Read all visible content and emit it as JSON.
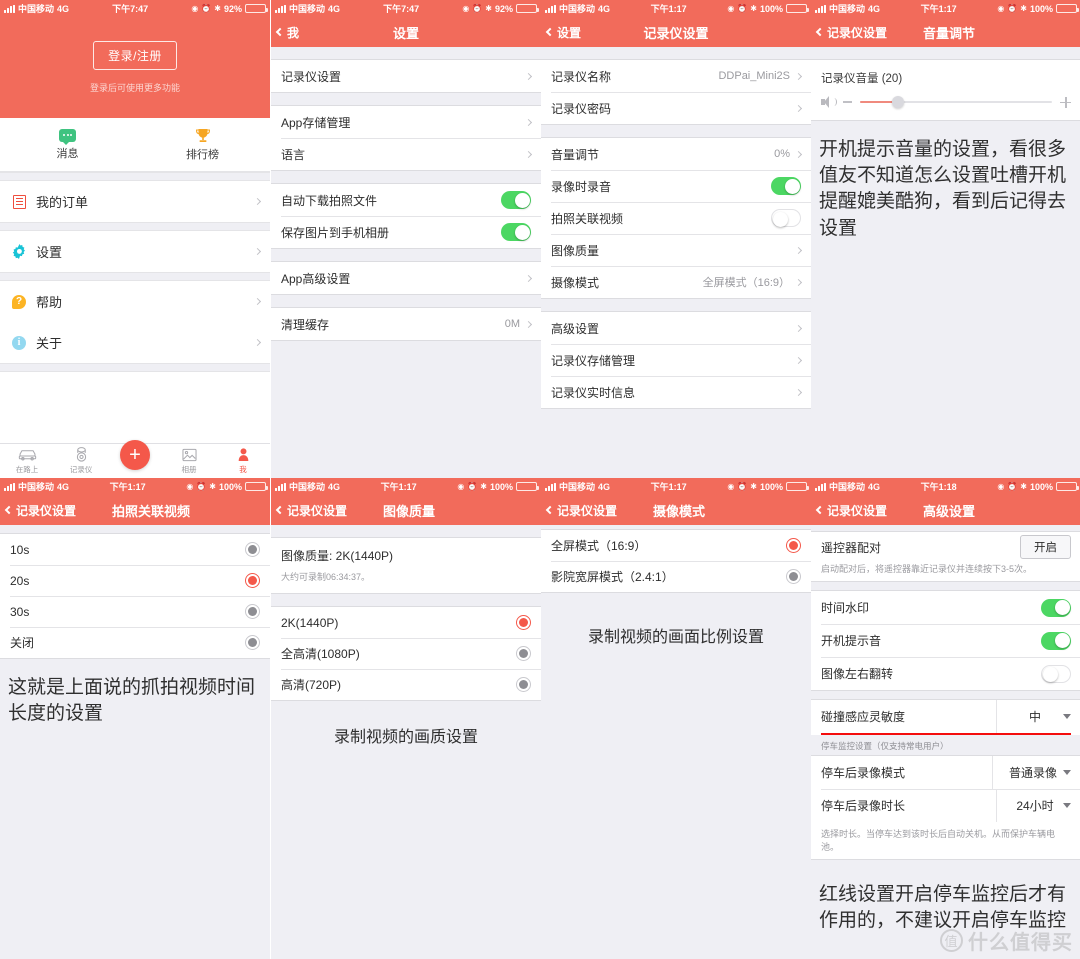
{
  "status_bars": {
    "carrier": "中国移动",
    "network": "4G",
    "time_747": "下午7:47",
    "time_117": "下午1:17",
    "time_118": "下午1:18",
    "battery_92": "92%",
    "battery_100": "100%"
  },
  "panel1": {
    "login_button": "登录/注册",
    "login_hint": "登录后可使用更多功能",
    "quick": [
      {
        "label": "消息",
        "icon": "chat-bubble-icon"
      },
      {
        "label": "排行榜",
        "icon": "trophy-icon"
      }
    ],
    "menu": [
      {
        "label": "我的订单",
        "icon": "order-list-icon"
      },
      {
        "label": "设置",
        "icon": "gear-icon"
      },
      {
        "label": "帮助",
        "icon": "help-icon"
      },
      {
        "label": "关于",
        "icon": "info-icon"
      }
    ],
    "tabs": [
      {
        "label": "在路上",
        "icon": "car-icon",
        "active": false
      },
      {
        "label": "记录仪",
        "icon": "dashcam-icon",
        "active": false
      },
      {
        "label": "",
        "icon": "plus-icon",
        "active": false
      },
      {
        "label": "相册",
        "icon": "photo-icon",
        "active": false
      },
      {
        "label": "我",
        "icon": "person-icon",
        "active": true
      }
    ]
  },
  "panel2": {
    "back": "我",
    "title": "设置",
    "rows_g1": [
      {
        "label": "记录仪设置"
      }
    ],
    "rows_g2": [
      {
        "label": "App存储管理"
      },
      {
        "label": "语言"
      }
    ],
    "rows_g3": [
      {
        "label": "自动下载拍照文件",
        "toggle": "on"
      },
      {
        "label": "保存图片到手机相册",
        "toggle": "on"
      }
    ],
    "rows_g4": [
      {
        "label": "App高级设置"
      }
    ],
    "rows_g5": [
      {
        "label": "清理缓存",
        "value": "0M"
      }
    ]
  },
  "panel3": {
    "back": "设置",
    "title": "记录仪设置",
    "rows_g1": [
      {
        "label": "记录仪名称",
        "value": "DDPai_Mini2S"
      },
      {
        "label": "记录仪密码",
        "value": ""
      }
    ],
    "rows_g2": [
      {
        "label": "音量调节",
        "value": "0%"
      },
      {
        "label": "录像时录音",
        "toggle": "on"
      },
      {
        "label": "拍照关联视频",
        "toggle": "off"
      },
      {
        "label": "图像质量",
        "value": ""
      },
      {
        "label": "摄像模式",
        "value": "全屏模式（16:9）"
      }
    ],
    "rows_g3": [
      {
        "label": "高级设置"
      },
      {
        "label": "记录仪存储管理"
      },
      {
        "label": "记录仪实时信息"
      }
    ]
  },
  "panel4": {
    "back": "记录仪设置",
    "title": "音量调节",
    "volume_label": "记录仪音量 (20)",
    "volume_percent": 20,
    "annotation": "开机提示音量的设置，看很多值友不知道怎么设置吐槽开机提醒媲美酷狗，看到后记得去设置"
  },
  "panel5": {
    "back": "记录仪设置",
    "title": "拍照关联视频",
    "options": [
      {
        "label": "10s",
        "selected": false
      },
      {
        "label": "20s",
        "selected": true
      },
      {
        "label": "30s",
        "selected": false
      },
      {
        "label": "关闭",
        "selected": false
      }
    ],
    "annotation": "这就是上面说的抓拍视频时间长度的设置"
  },
  "panel6": {
    "back": "记录仪设置",
    "title": "图像质量",
    "current_title": "图像质量: 2K(1440P)",
    "current_sub": "大约可录制06:34:37。",
    "options": [
      {
        "label": "2K(1440P)",
        "selected": true
      },
      {
        "label": "全高清(1080P)",
        "selected": false
      },
      {
        "label": "高清(720P)",
        "selected": false
      }
    ],
    "annotation": "录制视频的画质设置"
  },
  "panel7": {
    "back": "记录仪设置",
    "title": "摄像模式",
    "options": [
      {
        "label": "全屏模式（16:9）",
        "selected": true
      },
      {
        "label": "影院宽屏模式（2.4:1）",
        "selected": false
      }
    ],
    "annotation": "录制视频的画面比例设置"
  },
  "panel8": {
    "back": "记录仪设置",
    "title": "高级设置",
    "pair_label": "遥控器配对",
    "pair_button": "开启",
    "pair_note": "启动配对后，将遥控器靠近记录仪并连续按下3-5次。",
    "toggles": [
      {
        "label": "时间水印",
        "toggle": "on"
      },
      {
        "label": "开机提示音",
        "toggle": "on"
      },
      {
        "label": "图像左右翻转",
        "toggle": "off"
      }
    ],
    "sensitivity": {
      "label": "碰撞感应灵敏度",
      "value": "中"
    },
    "park_section": "停车监控设置（仅支持常电用户）",
    "park_rows": [
      {
        "label": "停车后录像模式",
        "value": "普通录像"
      },
      {
        "label": "停车后录像时长",
        "value": "24小时"
      }
    ],
    "park_note": "选择时长。当停车达到该时长后自动关机。从而保护车辆电池。",
    "annotation": "红线设置开启停车监控后才有作用的，不建议开启停车监控"
  },
  "watermark": {
    "mark": "值",
    "text": "什么值得买"
  },
  "colors": {
    "brand": "#f26b5b",
    "accent_red": "#f4584a",
    "toggle_green": "#4cd763",
    "redline": "#f40d0d"
  }
}
